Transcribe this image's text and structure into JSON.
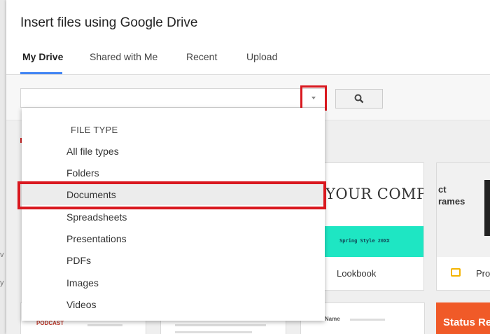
{
  "dialog": {
    "title": "Insert files using Google Drive"
  },
  "tabs": [
    {
      "label": "My Drive",
      "active": true
    },
    {
      "label": "Shared with Me"
    },
    {
      "label": "Recent"
    },
    {
      "label": "Upload"
    }
  ],
  "search": {
    "value": "",
    "placeholder": ""
  },
  "file_type_menu": {
    "header": "FILE TYPE",
    "items": [
      "All file types",
      "Folders",
      "Documents",
      "Spreadsheets",
      "Presentations",
      "PDFs",
      "Images",
      "Videos"
    ],
    "selected": "Documents"
  },
  "cards": {
    "company": {
      "preview_text": "YOUR COMPANY",
      "band_text": "Spring Style 20XX",
      "label": "Lookbook"
    },
    "project": {
      "line1": "ct",
      "line2": "rames",
      "label": "Proj"
    },
    "status": {
      "text": "Status Re"
    },
    "bottom_left": {
      "text": "PODCAST"
    },
    "bottom_mid": {
      "text": "Your Name"
    }
  },
  "page_edge": {
    "letters": [
      "v",
      "y"
    ]
  },
  "colors": {
    "highlight": "#d9181f",
    "tab_accent": "#4285f4",
    "band": "#1ee6c3",
    "status_card": "#f05a28"
  }
}
